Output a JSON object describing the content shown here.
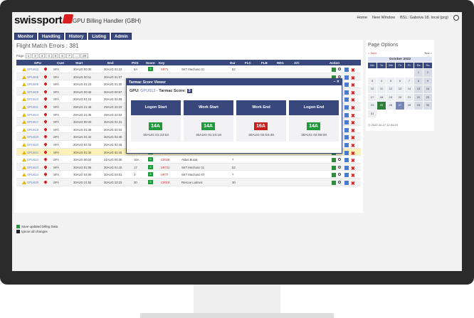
{
  "header": {
    "logo": "swissport",
    "app_title": "GPU Billing Handler (GBH)",
    "links": [
      "Home",
      "New Window",
      "BSL: Gabova 18. local (prg)"
    ]
  },
  "tabs": [
    "Monitor",
    "Handling",
    "History",
    "Listing",
    "Admin"
  ],
  "main": {
    "title": "Flight Match Errors : 381",
    "pager": [
      "Page:",
      "1",
      "2",
      "3",
      "4",
      "5",
      "6",
      "7",
      "...",
      "20"
    ],
    "columns": [
      "GPU",
      "Cust",
      "Start",
      "End",
      "POS",
      "Score",
      "Key",
      "Dur",
      "FLC",
      "FLB",
      "REG",
      "A/C",
      "Action"
    ],
    "rows": [
      {
        "gpu": "GPU612",
        "cust": "SFA",
        "start": "30AUG 00:30",
        "end": "30AUG 01:22",
        "pos": "5A",
        "score": "9",
        "key": "SR71",
        "desc": "SKT Mechano 01",
        "dur": "52"
      },
      {
        "gpu": "GPU605",
        "cust": "SFA",
        "start": "30AUG 00:11",
        "end": "30AUG 01:07",
        "pos": "",
        "score": "",
        "key": "",
        "desc": "",
        "dur": ""
      },
      {
        "gpu": "GPU608",
        "cust": "SFA",
        "start": "30AUG 01:23",
        "end": "30AUG 01:30",
        "pos": "",
        "score": "",
        "key": "",
        "desc": "",
        "dur": ""
      },
      {
        "gpu": "GPU609",
        "cust": "SFA",
        "start": "30AUG 00:42",
        "end": "30AUG 00:57",
        "pos": "",
        "score": "",
        "key": "",
        "desc": "",
        "dur": ""
      },
      {
        "gpu": "GPU610",
        "cust": "SFA",
        "start": "30AUG 01:23",
        "end": "30AUG 02:09",
        "pos": "",
        "score": "",
        "key": "",
        "desc": "",
        "dur": ""
      },
      {
        "gpu": "GPU611",
        "cust": "SFA",
        "start": "29AUG 21:46",
        "end": "29AUG 22:22",
        "pos": "",
        "score": "",
        "key": "",
        "desc": "",
        "dur": ""
      },
      {
        "gpu": "GPU614",
        "cust": "SFA",
        "start": "29AUG 21:35",
        "end": "29AUG 22:02",
        "pos": "",
        "score": "",
        "key": "",
        "desc": "",
        "dur": ""
      },
      {
        "gpu": "GPU617",
        "cust": "SFA",
        "start": "30AUG 00:33",
        "end": "30AUG 01:31",
        "pos": "",
        "score": "",
        "key": "",
        "desc": "",
        "dur": ""
      },
      {
        "gpu": "GPU618",
        "cust": "SFA",
        "start": "30AUG 01:39",
        "end": "30AUG 02:04",
        "pos": "",
        "score": "",
        "key": "",
        "desc": "",
        "dur": ""
      },
      {
        "gpu": "GPU619",
        "cust": "SFA",
        "start": "30AUG 01:44",
        "end": "30AUG 02:40",
        "pos": "",
        "score": "",
        "key": "",
        "desc": "",
        "dur": ""
      },
      {
        "gpu": "GPU620",
        "cust": "SFA",
        "start": "30AUG 02:33",
        "end": "30AUG 02:45",
        "pos": "",
        "score": "",
        "key": "",
        "desc": "",
        "dur": ""
      },
      {
        "gpu": "GPU621",
        "cust": "SFA",
        "start": "30AUG 01:34",
        "end": "30AUG 02:46",
        "pos": "14A",
        "score": "8",
        "key": "C0082",
        "desc": "Cleaner Staff",
        "dur": "43"
      },
      {
        "gpu": "GPU622",
        "cust": "SFA",
        "start": "30AUG 00:24",
        "end": "31AUG 00:30",
        "pos": "16A",
        "score": "6",
        "key": "C0048",
        "desc": "Aktas Burak",
        "dur": "7"
      },
      {
        "gpu": "GPU623",
        "cust": "SFA",
        "start": "30AUG 01:05",
        "end": "30AUG 01:15",
        "pos": "17",
        "score": "8",
        "key": "SR711",
        "desc": "SKT Mechano 11",
        "dur": "52"
      },
      {
        "gpu": "GPU624",
        "cust": "SFA",
        "start": "30AUG 02:00",
        "end": "30AUG 03:01",
        "pos": "3",
        "score": "8",
        "key": "SR77",
        "desc": "SKT Mechano 07",
        "dur": "7"
      },
      {
        "gpu": "GPU625",
        "cust": "SFA",
        "start": "30AUG 21:52",
        "end": "30AUG 22:22",
        "pos": "30",
        "score": "5",
        "key": "C0019",
        "desc": "Rescue Ludovic",
        "dur": "30"
      }
    ],
    "options": [
      "Save updated billing Data",
      "Ignore all changes"
    ]
  },
  "side": {
    "title": "Page Options",
    "prev": "< Sept",
    "next": "Nov >",
    "month": "October 2022",
    "days_header": [
      "Mo",
      "Tu",
      "We",
      "Th",
      "Fr",
      "Sa",
      "Su"
    ],
    "days": [
      "",
      "",
      "",
      "",
      "",
      "1",
      "2",
      "3",
      "4",
      "5",
      "6",
      "7",
      "8",
      "9",
      "10",
      "11",
      "12",
      "13",
      "14",
      "15",
      "16",
      "17",
      "18",
      "19",
      "20",
      "21",
      "22",
      "23",
      "24",
      "25",
      "26",
      "27",
      "28",
      "29",
      "30",
      "31",
      "",
      "",
      "",
      "",
      "",
      ""
    ],
    "selected_day": "25",
    "today_day": "27",
    "timestamp": "2022-10-27 12:04:29"
  },
  "modal": {
    "title": "Tarmac Score Viewer",
    "controls": "– ✕",
    "gpu_label": "GPU:",
    "gpu_id": "GPU613",
    "sep": "-",
    "score_label": "Tarmac Score:",
    "score": "3",
    "cards": [
      {
        "title": "Logon Start",
        "gate": "14A",
        "gate_color": "#1f9a3a",
        "time": "30AUG 01:23:53"
      },
      {
        "title": "Work Start",
        "gate": "14A",
        "gate_color": "#1f9a3a",
        "time": "30AUG 01:24:18"
      },
      {
        "title": "Work End",
        "gate": "16A",
        "gate_color": "#c81e1e",
        "time": "30AUG 02:04:48"
      },
      {
        "title": "Logon End",
        "gate": "14A",
        "gate_color": "#1f9a3a",
        "time": "30AUG 02:05:08"
      }
    ]
  },
  "colors": {
    "brand": "#d81e1e",
    "nav": "#39487c",
    "ok": "#1f9a3a",
    "bad": "#c81e1e",
    "highlight": "#fbf0b8"
  }
}
